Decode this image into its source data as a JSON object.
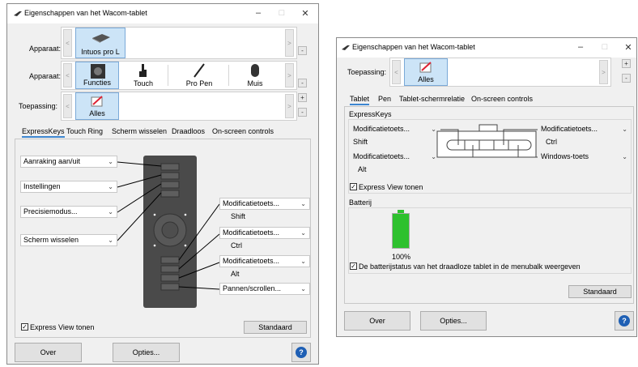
{
  "left": {
    "title": "Eigenschappen van het Wacom-tablet",
    "window_controls": {
      "minimize": "–",
      "maximize": "□",
      "close": "✕"
    },
    "device_label": "Apparaat:",
    "device_tile": "Intuos pro L",
    "tool_label": "Apparaat:",
    "tools": [
      "Functies",
      "Touch",
      "Pro Pen",
      "Muis"
    ],
    "app_label": "Toepassing:",
    "app_tile": "Alles",
    "tabs": [
      "ExpressKeys",
      "Touch Ring",
      "Scherm wisselen",
      "Draadloos",
      "On-screen controls"
    ],
    "left_dropdowns": [
      "Aanraking aan/uit",
      "Instellingen",
      "Precisiemodus...",
      "Scherm wisselen"
    ],
    "right_dropdowns": [
      {
        "value": "Modificatietoets...",
        "sub": "Shift"
      },
      {
        "value": "Modificatietoets...",
        "sub": "Ctrl"
      },
      {
        "value": "Modificatietoets...",
        "sub": "Alt"
      },
      {
        "value": "Pannen/scrollen...",
        "sub": ""
      }
    ],
    "express_view": "Express View tonen",
    "default_button": "Standaard",
    "about_button": "Over",
    "options_button": "Opties..."
  },
  "right": {
    "title": "Eigenschappen van het Wacom-tablet",
    "window_controls": {
      "minimize": "–",
      "maximize": "□",
      "close": "✕"
    },
    "app_label": "Toepassing:",
    "app_tile": "Alles",
    "tabs": [
      "Tablet",
      "Pen",
      "Tablet-schermrelatie",
      "On-screen controls"
    ],
    "expresskeys_group": "ExpressKeys",
    "keys": [
      {
        "value": "Modificatietoets...",
        "sub": "Shift"
      },
      {
        "value": "Modificatietoets...",
        "sub": "Ctrl"
      },
      {
        "value": "Modificatietoets...",
        "sub": "Alt"
      },
      {
        "value": "Windows-toets",
        "sub": ""
      }
    ],
    "express_view": "Express View tonen",
    "battery_group": "Batterij",
    "battery_percent": "100%",
    "battery_level": 1.0,
    "battery_status_check": "De batterijstatus van het draadloze tablet in de menubalk weergeven",
    "default_button": "Standaard",
    "about_button": "Over",
    "options_button": "Opties..."
  },
  "colors": {
    "selected_tile": "#cce4f7",
    "battery_green": "#2ec12e",
    "tab_accent": "#3d86d0",
    "help_blue": "#1e5fb4"
  },
  "icons": {
    "pen": "pen-icon",
    "help": "help-icon",
    "chevron": "chevron-down-icon"
  }
}
